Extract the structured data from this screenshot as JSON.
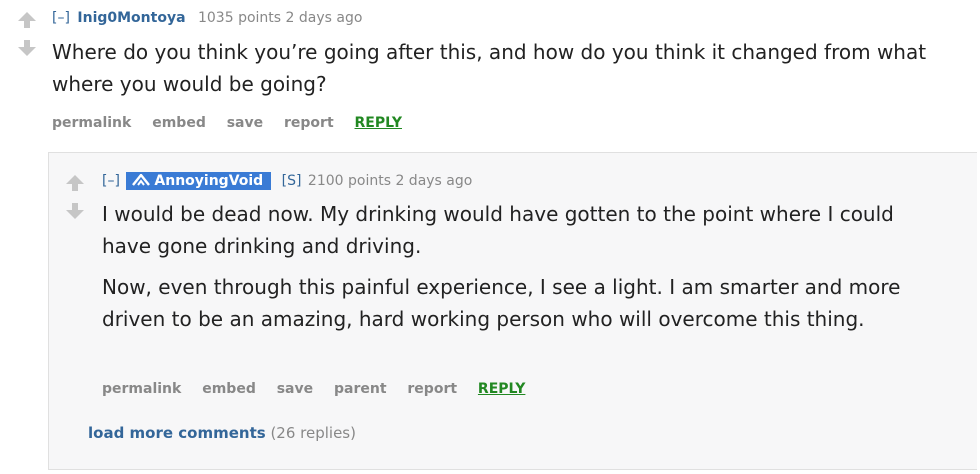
{
  "parent_comment": {
    "expand": "[–]",
    "author": "Inig0Montoya",
    "score": "1035 points",
    "time": "2 days ago",
    "body": "Where do you think you’re going after this, and how do you think it changed from what where you would be going?",
    "buttons": {
      "permalink": "permalink",
      "embed": "embed",
      "save": "save",
      "report": "report",
      "reply": "REPLY"
    }
  },
  "child_comment": {
    "expand": "[–]",
    "author": "AnnoyingVoid",
    "submitter_tag": "[S]",
    "score": "2100 points",
    "time": "2 days ago",
    "body_p1": "I would be dead now. My drinking would have gotten to the point where I could have gone drinking and driving.",
    "body_p2": "Now, even through this painful experience, I see a light. I am smarter and more driven to be an amazing, hard working person who will overcome this thing.",
    "buttons": {
      "permalink": "permalink",
      "embed": "embed",
      "save": "save",
      "parent": "parent",
      "report": "report",
      "reply": "REPLY"
    }
  },
  "load_more": {
    "label": "load more comments",
    "count": "(26 replies)"
  },
  "colors": {
    "link": "#336699",
    "reply": "#228822",
    "flair": "#3a7bd5",
    "muted": "#888888"
  },
  "icons": [
    "upvote-arrow-icon",
    "downvote-arrow-icon",
    "flair-logo-icon"
  ]
}
